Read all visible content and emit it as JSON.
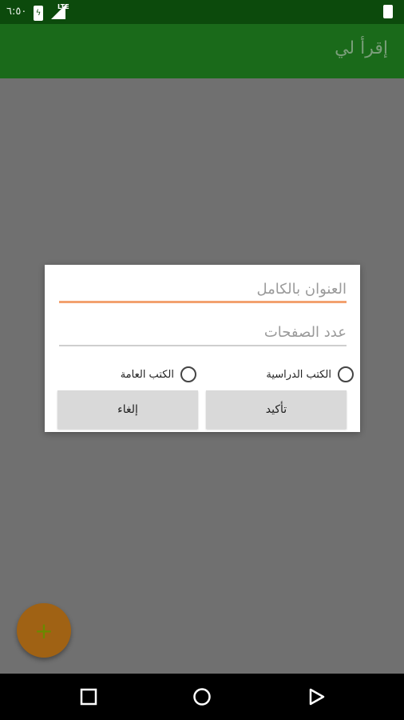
{
  "status_bar": {
    "time": "٦:٥٠",
    "network": "LTE"
  },
  "app_bar": {
    "title": "إقرأ لي"
  },
  "dialog": {
    "title_field": {
      "placeholder": "العنوان بالكامل"
    },
    "pages_field": {
      "placeholder": "عدد الصفحات"
    },
    "radio_study": "الكتب الدراسية",
    "radio_general": "الكتب العامة",
    "confirm_label": "تأكيد",
    "cancel_label": "إلغاء"
  },
  "fab": {
    "label": "+"
  },
  "colors": {
    "app_bar": "#1a6a1a",
    "status_bar": "#0c4a0c",
    "fab": "#a06214",
    "field_accent": "#f2a16f"
  },
  "icons": {
    "nav": [
      "recents-square-icon",
      "home-circle-icon",
      "back-triangle-icon"
    ]
  }
}
